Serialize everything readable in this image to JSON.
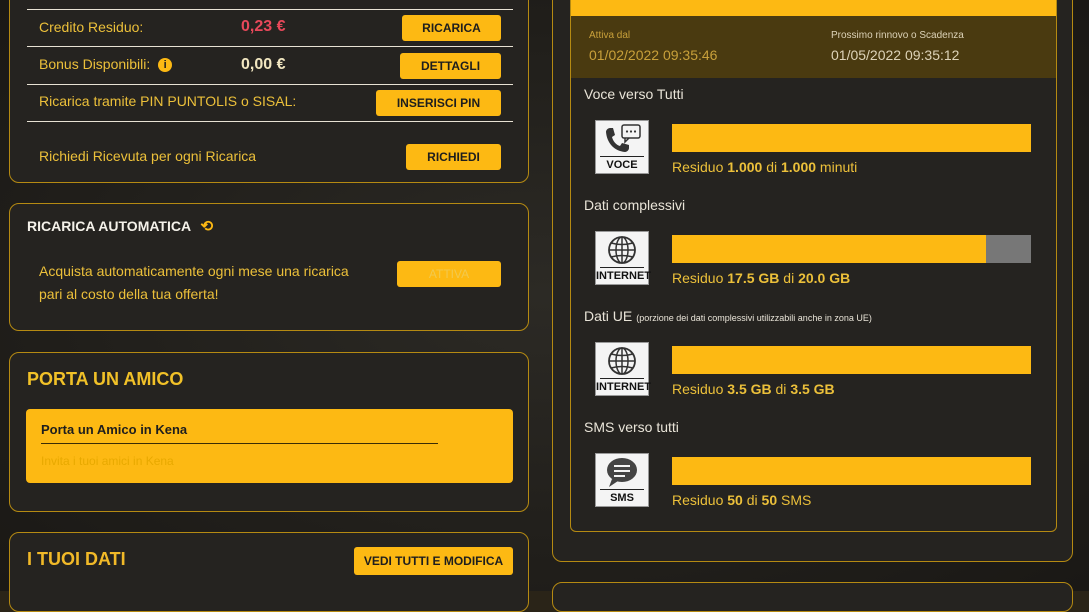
{
  "credit": {
    "credito_label": "Credito Residuo:",
    "credito_value": "0,23 €",
    "ricarica_btn": "RICARICA",
    "bonus_label": "Bonus Disponibili:",
    "bonus_value": "0,00 €",
    "dettagli_btn": "DETTAGLI",
    "pin_label": "Ricarica tramite PIN PUNTOLIS o SISAL:",
    "pin_btn": "INSERISCI PIN",
    "ricevuta_label": "Richiedi Ricevuta per ogni Ricarica",
    "richiedi_btn": "RICHIEDI"
  },
  "auto_recharge": {
    "title": "RICARICA AUTOMATICA",
    "desc_line1": "Acquista automaticamente ogni mese una ricarica",
    "desc_line2": "pari al costo della tua offerta!",
    "button": "ATTIVA"
  },
  "friend": {
    "title": "PORTA UN AMICO",
    "box_title": "Porta un Amico in Kena",
    "box_sub": "Invita i tuoi amici in Kena"
  },
  "data": {
    "title": "I TUOI DATI",
    "button": "VEDI TUTTI E MODIFICA"
  },
  "offer": {
    "attiva_label": "Attiva dal",
    "attiva_value": "01/02/2022 09:35:46",
    "rinnovo_label": "Prossimo rinnovo o Scadenza",
    "rinnovo_value": "01/05/2022 09:35:12"
  },
  "usage": [
    {
      "label": "Voce verso Tutti",
      "note": "",
      "icon_caption": "VOCE",
      "icon": "phone-chat-icon",
      "fill": 1.0,
      "r_pre": "Residuo ",
      "r_a": "1.000",
      "r_mid": " di ",
      "r_b": "1.000",
      "r_post": " minuti"
    },
    {
      "label": "Dati complessivi",
      "note": "",
      "icon_caption": "INTERNET",
      "icon": "globe-icon",
      "fill": 0.875,
      "r_pre": "Residuo ",
      "r_a": "17.5 GB",
      "r_mid": " di ",
      "r_b": "20.0 GB",
      "r_post": ""
    },
    {
      "label": "Dati UE",
      "note": "(porzione dei dati complessivi utilizzabili anche in zona UE)",
      "icon_caption": "INTERNET",
      "icon": "globe-icon",
      "fill": 1.0,
      "r_pre": "Residuo ",
      "r_a": "3.5 GB",
      "r_mid": " di ",
      "r_b": "3.5 GB",
      "r_post": ""
    },
    {
      "label": "SMS verso tutti",
      "note": "",
      "icon_caption": "SMS",
      "icon": "sms-bubble-icon",
      "fill": 1.0,
      "r_pre": "Residuo ",
      "r_a": "50",
      "r_mid": " di ",
      "r_b": "50",
      "r_post": " SMS"
    }
  ],
  "colors": {
    "accent": "#fdb913",
    "negative": "#e8485a",
    "background": "#252320"
  }
}
